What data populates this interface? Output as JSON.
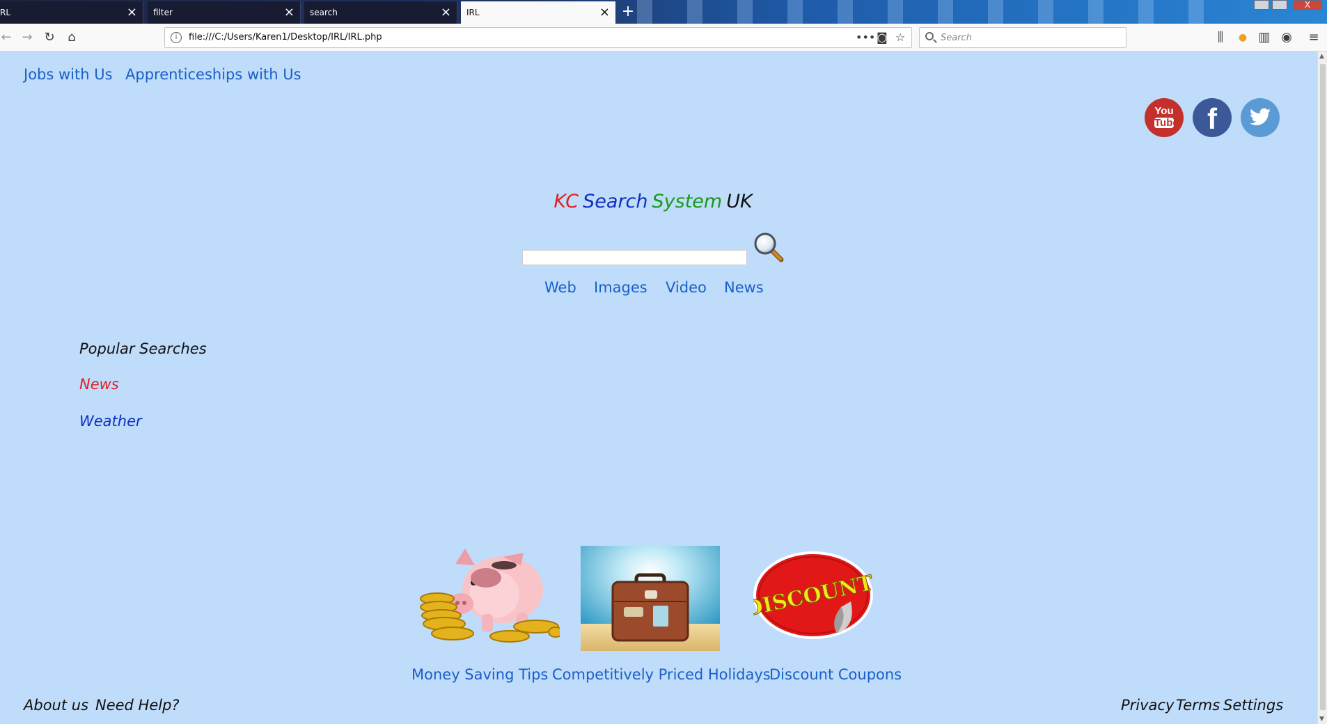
{
  "browser": {
    "tabs": [
      {
        "label": "RL",
        "active": false
      },
      {
        "label": "filter",
        "active": false
      },
      {
        "label": "search",
        "active": false
      },
      {
        "label": "IRL",
        "active": true
      }
    ],
    "url": "file:///C:/Users/Karen1/Desktop/IRL/IRL.php",
    "search_placeholder": "Search",
    "window_close": "X"
  },
  "header": {
    "links": [
      "Jobs with Us",
      "Apprenticeships with Us"
    ],
    "social": {
      "youtube_you": "You",
      "youtube_tube": "Tube",
      "facebook": "f"
    }
  },
  "title": {
    "parts": [
      {
        "text": "KC",
        "color": "#e02020"
      },
      {
        "text": "Search",
        "color": "#1030c0"
      },
      {
        "text": "System",
        "color": "#1a9a1a"
      },
      {
        "text": "UK",
        "color": "#111111"
      }
    ]
  },
  "search": {
    "value": ""
  },
  "verticals": [
    "Web",
    "Images",
    "Video",
    "News"
  ],
  "popular": {
    "heading": "Popular Searches",
    "items": [
      {
        "label": "News",
        "color": "#e02020"
      },
      {
        "label": "Weather",
        "color": "#1030c0"
      }
    ]
  },
  "promos": [
    {
      "caption": "Money Saving Tips",
      "image": "piggy-bank-with-coins"
    },
    {
      "caption": "Competitively Priced Holidays",
      "image": "suitcase-on-beach"
    },
    {
      "caption": "Discount Coupons",
      "image": "discount-sticker",
      "sticker_text": "DISCOUNT"
    }
  ],
  "footer": {
    "left": [
      "About us",
      "Need Help?"
    ],
    "right": [
      "Privacy",
      "Terms",
      "Settings"
    ]
  }
}
